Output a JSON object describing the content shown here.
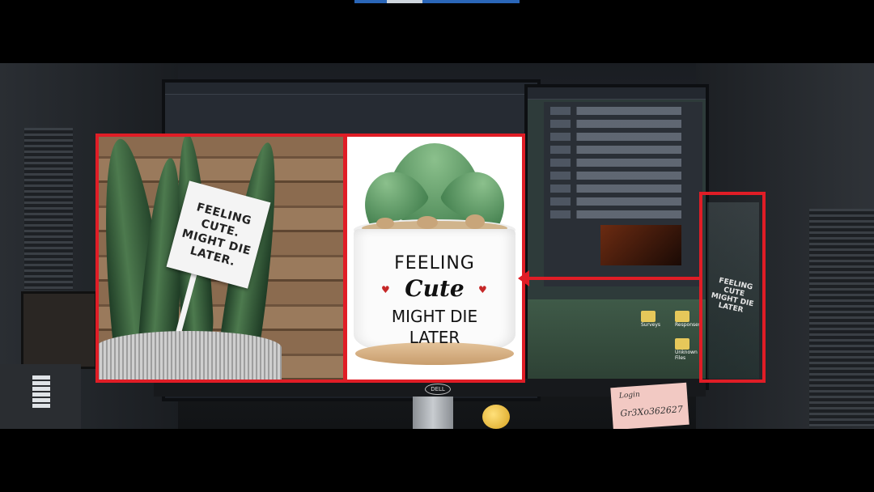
{
  "sign_lines": [
    "FEELING CUTE.",
    "MIGHT DIE",
    "LATER."
  ],
  "pot_text": {
    "line1": "FEELING",
    "line2": "Cute",
    "line3": "MIGHT DIE",
    "line4": "LATER"
  },
  "glass_text": "FEELING CUTE MIGHT DIE LATER",
  "monitor_brand": "DELL",
  "sticky_note": {
    "line1": "Login",
    "line2": "Gr3Xo362627"
  },
  "desktop_folders": [
    "Surveys",
    "Responses",
    "Unknown Files"
  ],
  "colors": {
    "highlight_red": "#e01d26"
  }
}
